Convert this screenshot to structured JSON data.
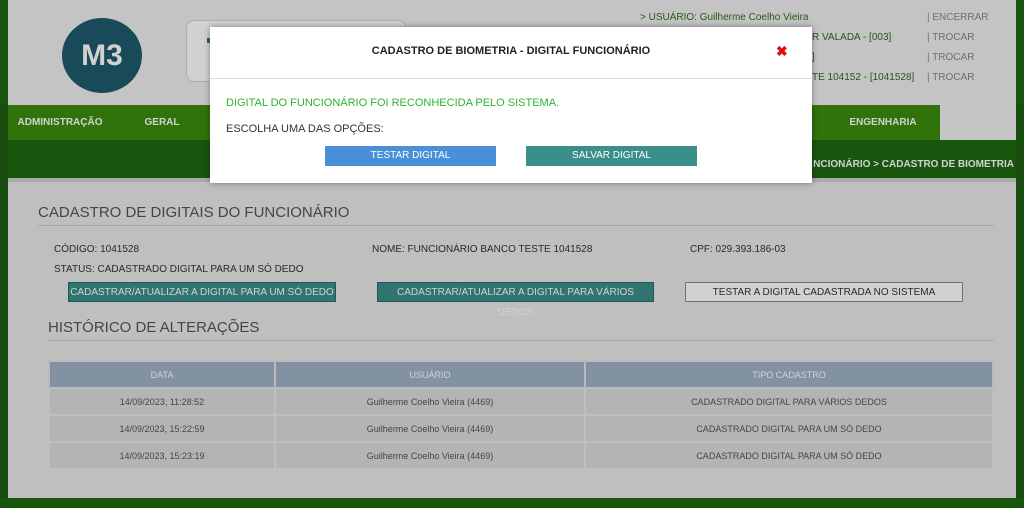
{
  "header": {
    "logo": "M3",
    "user_line": "> USUÁRIO: Guilherme Coelho Vieira",
    "line2_partial": "R VALADA - [003]",
    "line3_partial": "]",
    "line4_partial": "TE 104152 - [1041528]",
    "links": [
      "| ENCERRAR",
      "| TROCAR",
      "| TROCAR",
      "| TROCAR"
    ]
  },
  "nav": {
    "items": [
      "ADMINISTRAÇÃO",
      "GERAL",
      "ENGENHARIA"
    ]
  },
  "breadcrumb": "NCIONÁRIO > CADASTRO DE BIOMETRIA",
  "main": {
    "title": "CADASTRO DE DIGITAIS DO FUNCIONÁRIO",
    "codigo": "CÓDIGO: 1041528",
    "nome": "NOME: FUNCIONÁRIO BANCO TESTE 1041528",
    "cpf": "CPF: 029.393.186-03",
    "status": "STATUS: CADASTRADO DIGITAL PARA UM SÓ DEDO",
    "btn_one": "CADASTRAR/ATUALIZAR A DIGITAL PARA UM SÓ DEDO",
    "btn_many": "CADASTRAR/ATUALIZAR A DIGITAL PARA VÁRIOS DEDOS",
    "btn_test": "TESTAR A DIGITAL CADASTRADA NO SISTEMA",
    "history_title": "HISTÓRICO DE ALTERAÇÕES",
    "table": {
      "headers": [
        "DATA",
        "USUÁRIO",
        "TIPO CADASTRO"
      ],
      "rows": [
        [
          "14/09/2023, 11:28:52",
          "Guilherme Coelho Vieira (4469)",
          "CADASTRADO DIGITAL PARA VÁRIOS DEDOS"
        ],
        [
          "14/09/2023, 15:22:59",
          "Guilherme Coelho Vieira (4469)",
          "CADASTRADO DIGITAL PARA UM SÓ DEDO"
        ],
        [
          "14/09/2023, 15:23:19",
          "Guilherme Coelho Vieira (4469)",
          "CADASTRADO DIGITAL PARA UM SÓ DEDO"
        ]
      ]
    }
  },
  "modal": {
    "title": "CADASTRO DE BIOMETRIA - DIGITAL FUNCIONÁRIO",
    "close": "✖",
    "message": "DIGITAL DO FUNCIONÁRIO FOI RECONHECIDA PELO SISTEMA.",
    "prompt": "ESCOLHA UMA DAS OPÇÕES:",
    "btn_test": "TESTAR DIGITAL",
    "btn_save": "SALVAR DIGITAL"
  },
  "colors": {
    "brand_green": "#3c8d0e",
    "dark_green": "#1e6a12",
    "teal": "#3b8f8a",
    "blue": "#4a90d9",
    "success": "#2cb52c",
    "close_red": "#e01010"
  }
}
